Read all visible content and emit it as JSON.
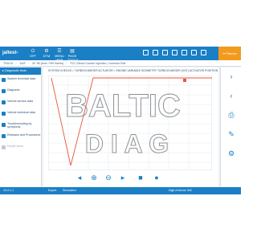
{
  "toolbar": {
    "logo_text": "jaltest",
    "tools": [
      {
        "label": "OFF",
        "glyph": "⏻"
      },
      {
        "label": "DTM",
        "glyph": "⚙"
      },
      {
        "label": "MENU\nWEB",
        "glyph": "☰"
      },
      {
        "label": "PAGE\nTOOLS",
        "glyph": "▤"
      }
    ],
    "action_label": "Planner"
  },
  "breadcrumb": [
    "TRUCK",
    "DAF",
    "XF 96 (from 7/99 Series)",
    "PCI, Diesel Control Injection, Common Rail"
  ],
  "sidebar": {
    "header": "Diagnostic tests",
    "items": [
      {
        "label": "System technical data",
        "enabled": true
      },
      {
        "label": "Diagrams",
        "enabled": true
      },
      {
        "label": "Vehicle service data",
        "enabled": true
      },
      {
        "label": "Vehicle technical data",
        "enabled": true
      },
      {
        "label": "Troubleshooting by symptoms",
        "enabled": true
      },
      {
        "label": "Releases and Procedures",
        "enabled": true
      },
      {
        "label": "Repair times",
        "enabled": false
      }
    ]
  },
  "main": {
    "title": "SYSTEM CHECKS > TURBOCHARGER ACTUATOR > ENGINE VARIABLE GEOMETRY TURBOCHARGER (VGT) ACTUATOR POSITION"
  },
  "status": {
    "left": "10.0.1.1",
    "user": "Expert",
    "mode": "Simulation",
    "right": "Digit eXtreme 300"
  },
  "watermark": {
    "line1": "BALTIC",
    "line2": "D I A G"
  },
  "colors": {
    "accent": "#1a7fc4",
    "action": "#f39a1e",
    "trace": "#e8553a"
  }
}
